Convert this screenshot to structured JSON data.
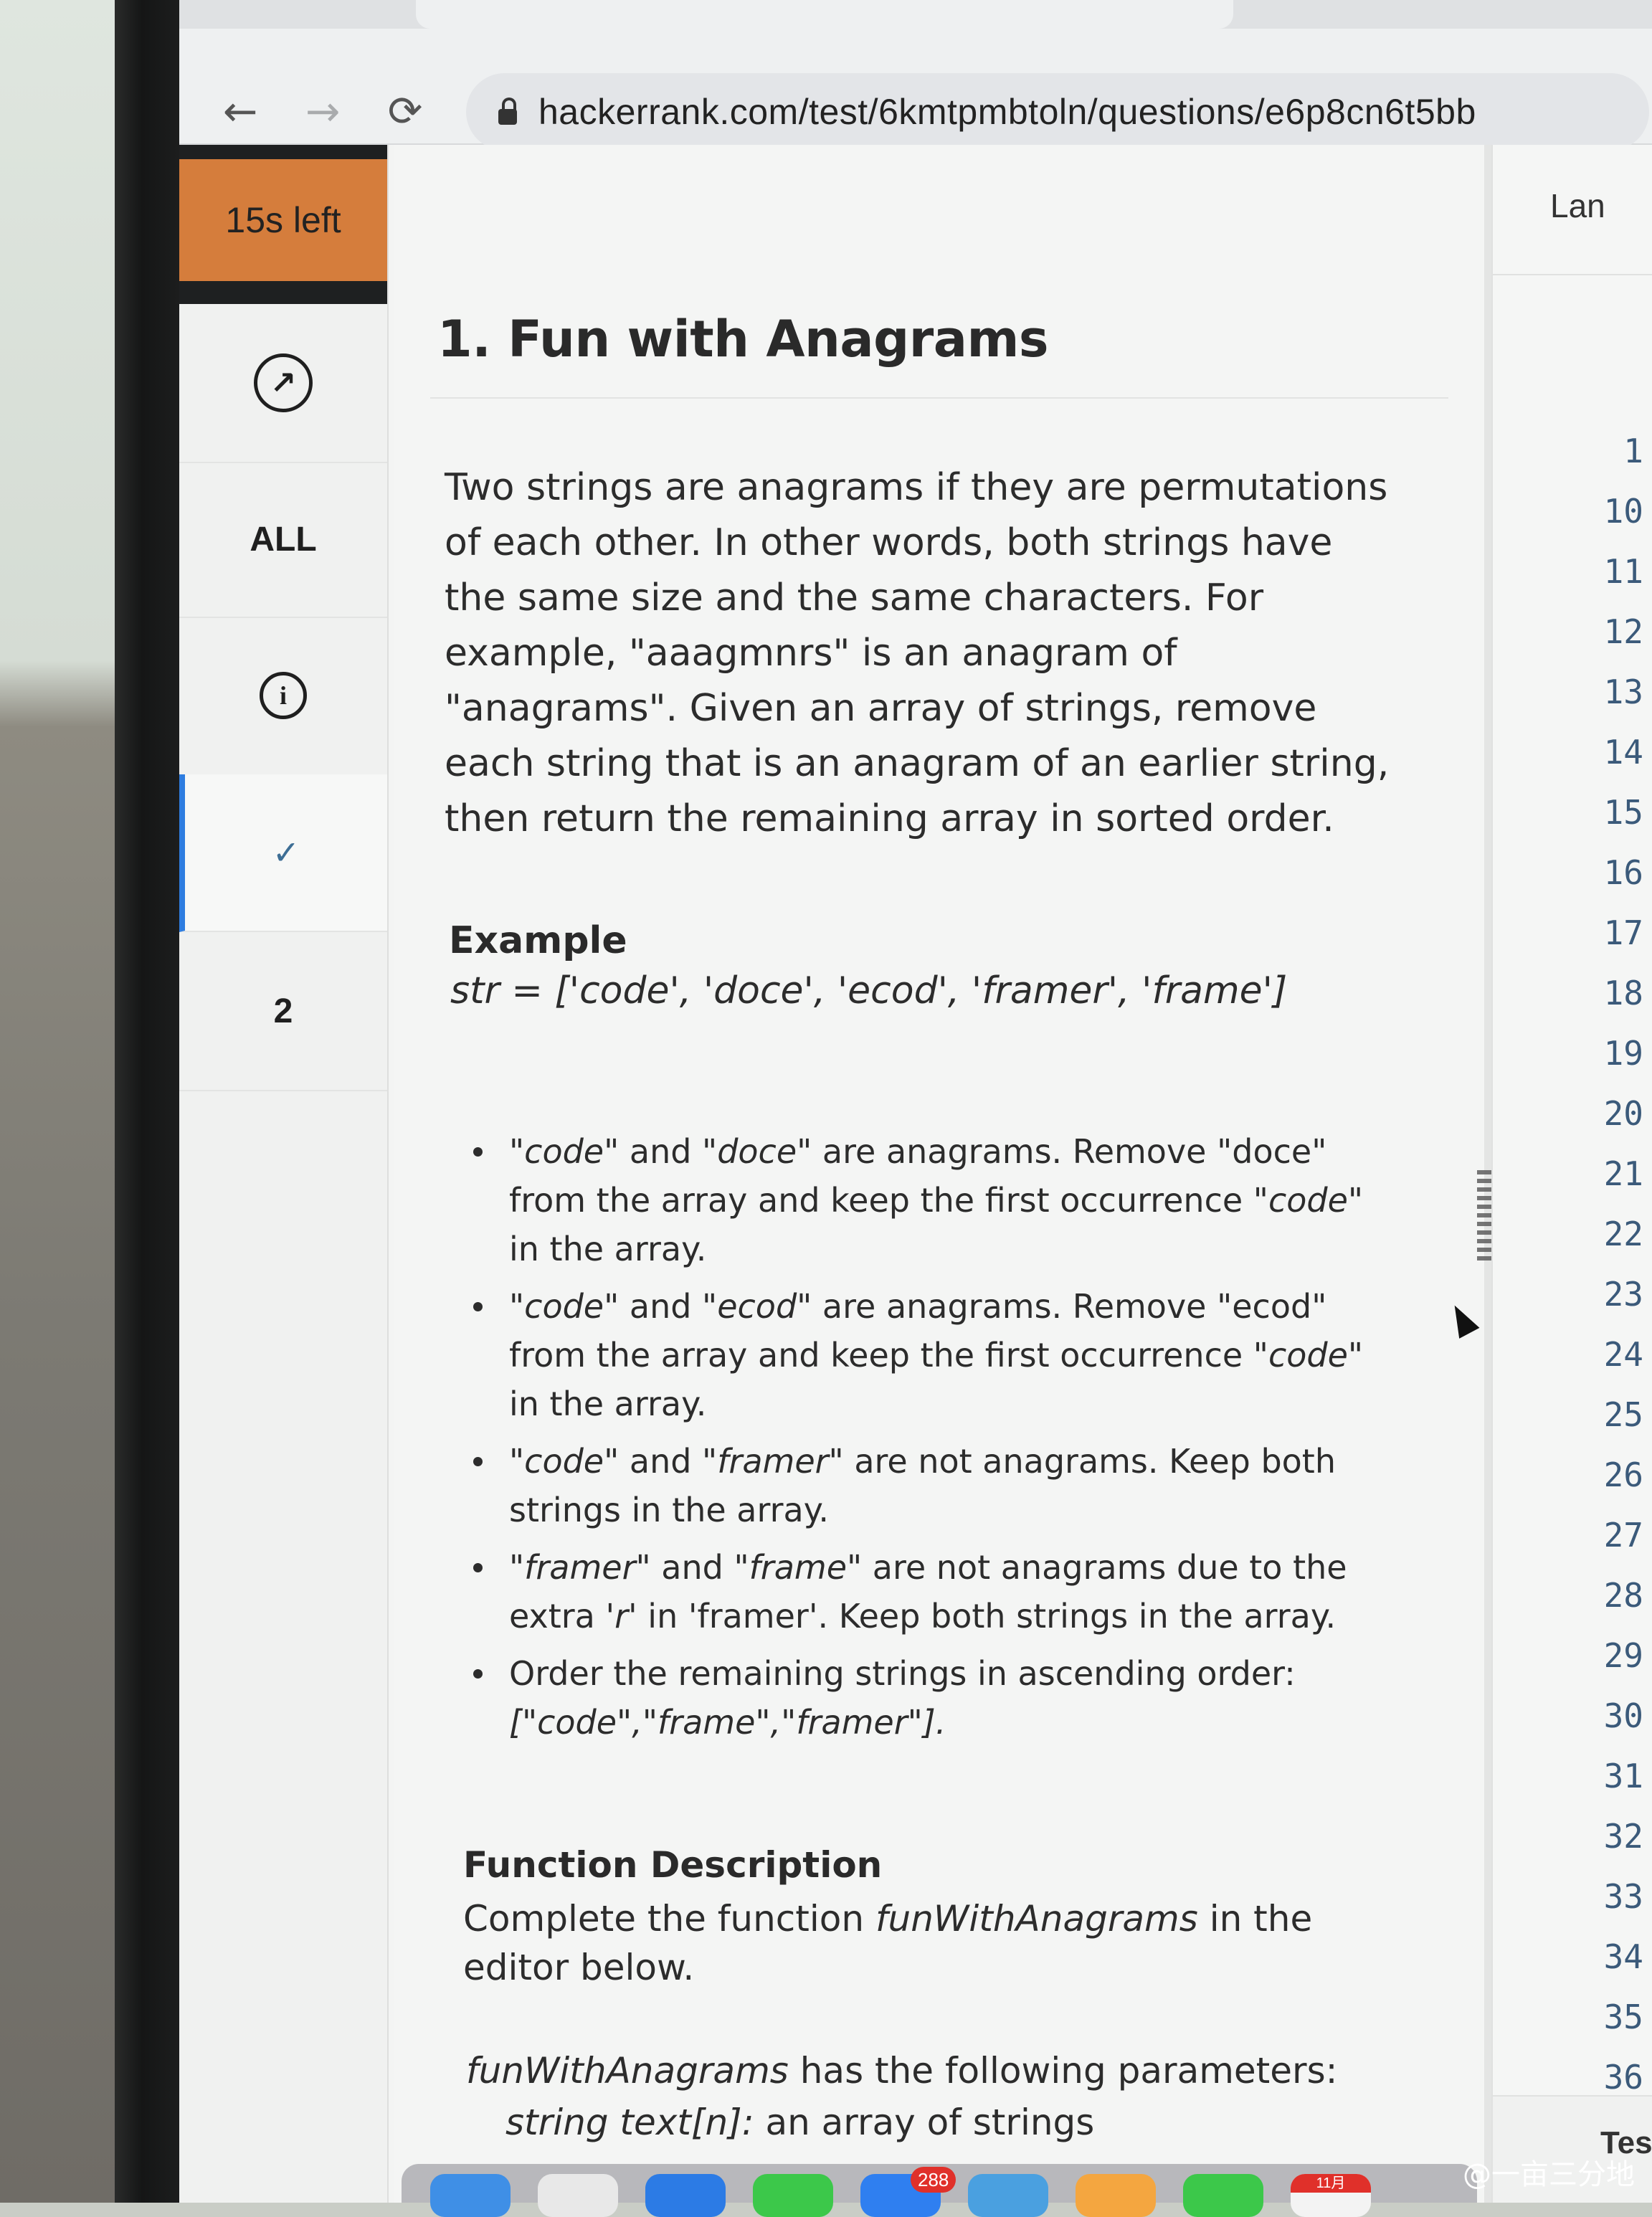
{
  "browser": {
    "url": "hackerrank.com/test/6kmtpmbtoln/questions/e6p8cn6t5bb",
    "back_icon": "←",
    "forward_icon": "→",
    "reload_icon": "⟳"
  },
  "sidebar": {
    "timer": "15s left",
    "timer_color": "#d57d3c",
    "items": [
      {
        "icon": "compass-icon",
        "glyph": "↗"
      },
      {
        "label": "ALL"
      },
      {
        "icon": "info-icon",
        "glyph": "i"
      },
      {
        "icon": "check-icon",
        "glyph": "✓"
      },
      {
        "label": "2"
      }
    ],
    "active_color": "#2e7de0"
  },
  "question": {
    "title": "1. Fun with Anagrams",
    "description": "Two strings are anagrams if they are permutations of each other. In other words, both strings have the same size and the same characters. For example, \"aaagmnrs\" is an anagram of \"anagrams\". Given an array of strings, remove each string that is an anagram of an earlier string, then return the remaining array in sorted order.",
    "example_heading": "Example",
    "example_str": "str = ['code', 'doce', 'ecod', 'framer', 'frame']",
    "bullets": [
      {
        "p1": "\"",
        "e1": "code",
        "p2": "\" and \"",
        "e2": "doce",
        "p3": "\" are anagrams. Remove \"doce\" from the array and keep the first occurrence ",
        "e3": "\"code\"",
        "p4": " in the array."
      },
      {
        "p1": "",
        "e1": "\"code\"",
        "p2": " and \"",
        "e2": "ecod",
        "p3": "\" are anagrams. Remove \"ecod\" from the array and keep the first occurrence ",
        "e3": "\"code\"",
        "p4": " in the array."
      },
      {
        "p1": "",
        "e1": "\"code\"",
        "p2": " and \"",
        "e2": "framer",
        "p3": "\" are not anagrams. Keep both strings in the array.",
        "e3": "",
        "p4": ""
      },
      {
        "p1": "\"",
        "e1": "framer",
        "p2": "\" and \"",
        "e2": "frame",
        "p3": "\" are not anagrams due to the extra ",
        "e3": "'r'",
        "p4": " in 'framer'. Keep both strings in the array."
      },
      {
        "p1": "Order the remaining strings in ascending order: ",
        "e1": "[\"code\",\"frame\",\"framer\"].",
        "p2": "",
        "e2": "",
        "p3": "",
        "e3": "",
        "p4": ""
      }
    ],
    "function_heading": "Function Description",
    "function_text_1": "Complete the function ",
    "function_name": "funWithAnagrams",
    "function_text_2": " in the editor below.",
    "params_intro_name": "funWithAnagrams",
    "params_intro_text": " has the following parameters:",
    "param_1_name": "string text[n]:",
    "param_1_desc": "  an array of strings"
  },
  "editor": {
    "language_label": "Lan",
    "line_numbers": [
      "1",
      "10",
      "11",
      "12",
      "13",
      "14",
      "15",
      "16",
      "17",
      "18",
      "19",
      "20",
      "21",
      "22",
      "23",
      "24",
      "25",
      "26",
      "27",
      "28",
      "29",
      "30",
      "31",
      "32",
      "33",
      "34",
      "35",
      "36"
    ],
    "fold_icon": "›",
    "footer_label": "Test"
  },
  "dock": {
    "badge_mail": "288",
    "calendar_month": "11月"
  },
  "watermark": "@一亩三分地"
}
